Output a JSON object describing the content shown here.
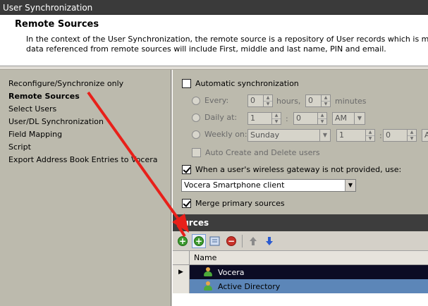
{
  "window": {
    "title": "User Synchronization"
  },
  "header": {
    "title": "Remote Sources",
    "description_line1": "In the context of the User Synchronization, the remote source is a repository of User records which is maintained by the or",
    "description_line2": "data referenced from remote sources will include First, middle and last name, PIN and email."
  },
  "nav": {
    "items": [
      {
        "label": "Reconfigure/Synchronize only"
      },
      {
        "label": "Remote Sources",
        "active": true
      },
      {
        "label": "Select Users"
      },
      {
        "label": "User/DL Synchronization"
      },
      {
        "label": "Field Mapping"
      },
      {
        "label": "Script"
      },
      {
        "label": "Export Address Book Entries to Vocera"
      }
    ]
  },
  "settings": {
    "auto_sync": {
      "label": "Automatic synchronization",
      "checked": false
    },
    "every": {
      "label": "Every:",
      "hours_value": "0",
      "hours_label": "hours,",
      "minutes_value": "0",
      "minutes_label": "minutes"
    },
    "daily": {
      "label": "Daily at:",
      "hour": "1",
      "minute": "0",
      "ampm": "AM"
    },
    "weekly": {
      "label": "Weekly on:",
      "day": "Sunday",
      "hour": "1",
      "minute": "0",
      "ampm": "A"
    },
    "time_separator": ":",
    "auto_create": {
      "label": "Auto Create and Delete users",
      "checked": false
    },
    "gateway": {
      "label": "When a user's wireless gateway is not provided, use:",
      "checked": true,
      "value": "Vocera Smartphone client"
    },
    "merge": {
      "label": "Merge primary sources",
      "checked": true
    }
  },
  "sources": {
    "header": "ources",
    "toolbar_icons": [
      "add-icon",
      "add-highlighted-icon",
      "edit-icon",
      "remove-icon",
      "move-up-icon",
      "move-down-icon"
    ],
    "column_name": "Name",
    "rows": [
      {
        "name": "Vocera",
        "selected": true
      },
      {
        "name": "Active Directory",
        "selected": false
      }
    ]
  },
  "colors": {
    "arrow": "#e8201a",
    "title_bar": "#3a3a3a",
    "selected_row": "#0c0c24",
    "alt_row": "#5c86b8"
  }
}
